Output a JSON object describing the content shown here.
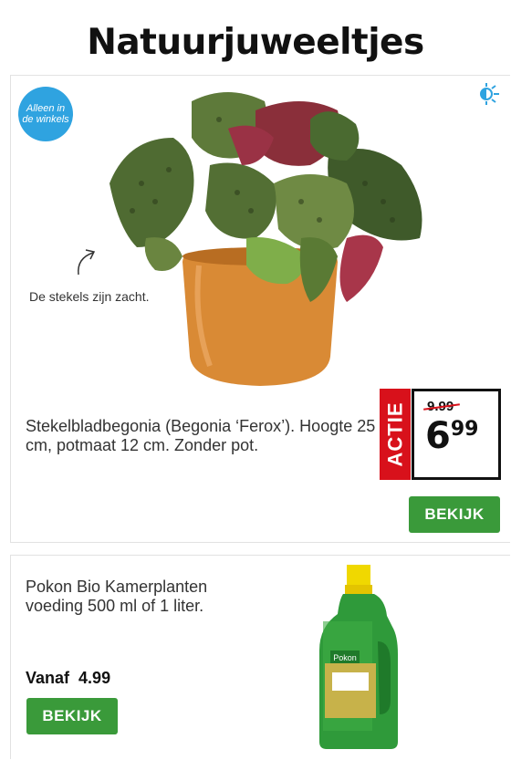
{
  "page": {
    "title": "Natuurjuweeltjes"
  },
  "card1": {
    "badge": "Alleen in de winkels",
    "icons": {
      "light": "sun-icon",
      "arrow": "curved-arrow-icon"
    },
    "note": "De stekels zijn zacht.",
    "description": "Stekelbladbegonia (Begonia ‘Ferox’). Hoogte 25 cm, potmaat 12 cm. Zonder pot.",
    "price": {
      "tag": "ACTIE",
      "old": "9.99",
      "new_main": "6",
      "new_cents": "99",
      "tag_color": "#d8111b"
    },
    "button_label": "BEKIJK",
    "button_color": "#3a9a3a"
  },
  "card2": {
    "name": "Pokon Bio Kamerplanten voeding 500 ml of 1 liter.",
    "price_label": "Vanaf",
    "price": "4.99",
    "bottle_brand": "Pokon",
    "button_label": "BEKIJK"
  }
}
